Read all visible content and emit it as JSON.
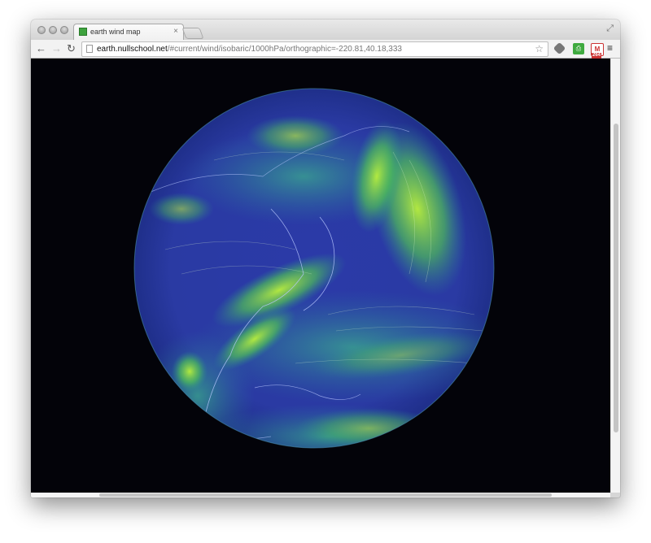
{
  "window": {
    "tab": {
      "title": "earth wind map",
      "close": "×"
    },
    "fullscreen_glyph": "⤢"
  },
  "toolbar": {
    "back_glyph": "←",
    "forward_glyph": "→",
    "reload_glyph": "↻",
    "url_domain": "earth.nullschool.net",
    "url_path": "/#current/wind/isobaric/1000hPa/orthographic=-220.81,40.18,333",
    "star_glyph": "☆",
    "menu_glyph": "≡",
    "extensions": [
      {
        "name": "evernote-icon",
        "label": ""
      },
      {
        "name": "printer-icon",
        "label": ""
      },
      {
        "name": "gmail-icon",
        "label": "M",
        "badge": "264"
      }
    ]
  },
  "map": {
    "projection": "orthographic",
    "ocean_color": "#2a38a8",
    "land_tint": "#2f52a0",
    "fast_wind_color": "#9be33b",
    "border_color": "#b9c8ff",
    "background_color": "#030309"
  }
}
